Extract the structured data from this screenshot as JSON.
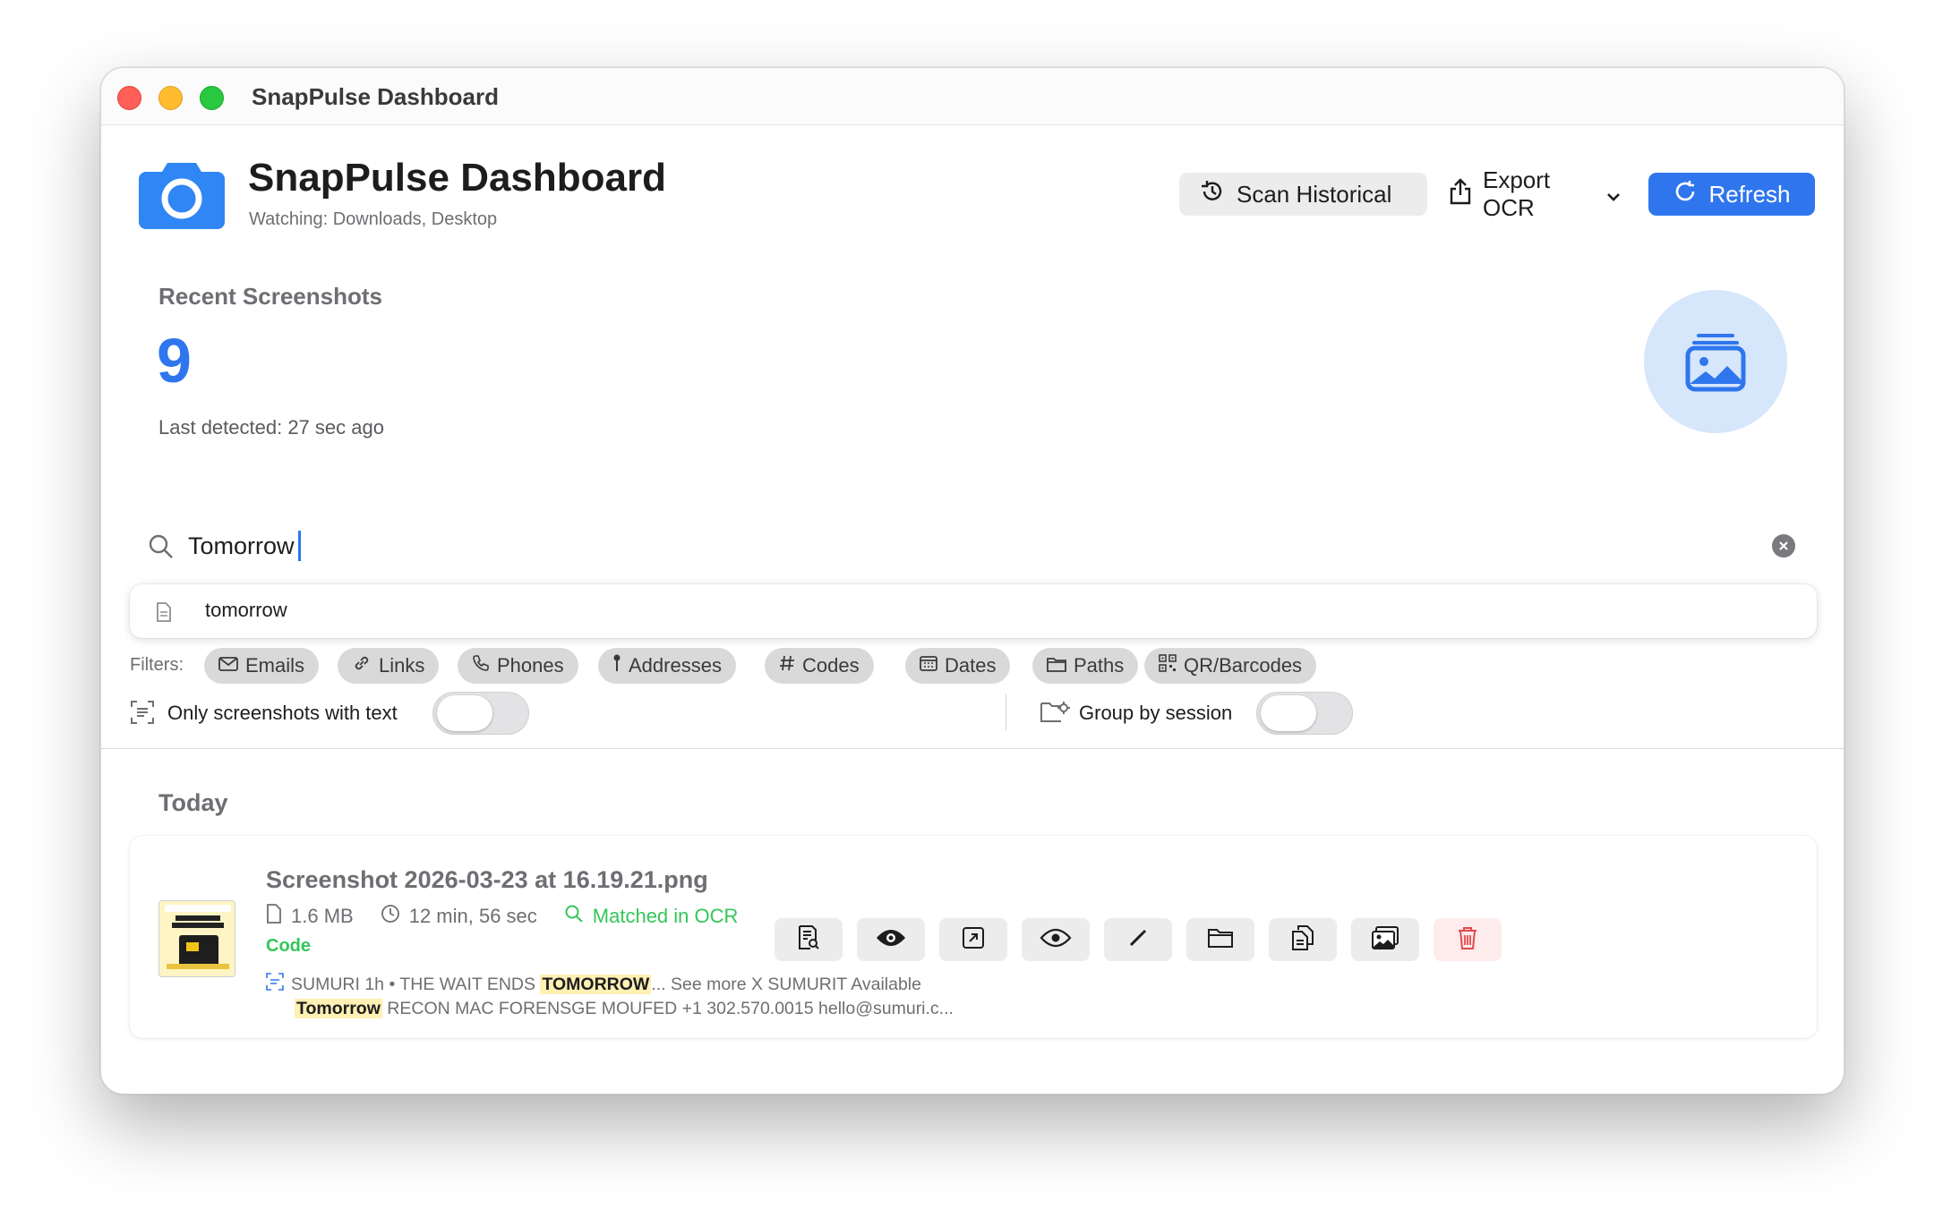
{
  "window": {
    "title": "SnapPulse Dashboard"
  },
  "header": {
    "title": "SnapPulse Dashboard",
    "watching": "Watching: Downloads, Desktop",
    "scan_label": "Scan Historical",
    "export_label": "Export OCR",
    "refresh_label": "Refresh"
  },
  "stats": {
    "label": "Recent Screenshots",
    "count": "9",
    "last_detected": "Last detected: 27 sec ago"
  },
  "search": {
    "value": "Tomorrow",
    "suggestion": "tomorrow"
  },
  "filters": {
    "label": "Filters:",
    "chips": [
      "Emails",
      "Links",
      "Phones",
      "Addresses",
      "Codes",
      "Dates",
      "Paths",
      "QR/Barcodes"
    ],
    "only_text_label": "Only screenshots with text",
    "group_label": "Group by session",
    "only_text_on": false,
    "group_on": false
  },
  "list": {
    "section": "Today",
    "items": [
      {
        "name": "Screenshot 2026-03-23 at 16.19.21.png",
        "size": "1.6 MB",
        "age": "12 min, 56 sec",
        "match": "Matched in OCR",
        "tag": "Code",
        "ocr_a": "SUMURI 1h • THE WAIT ENDS ",
        "ocr_hl1": "TOMORROW",
        "ocr_b": "... See more X SUMURIT Available",
        "ocr_hl2": "Tomorrow",
        "ocr_c": " RECON MAC FORENSGE MOUFED +1 302.570.0015 hello@sumuri.c..."
      }
    ]
  },
  "colors": {
    "accent": "#2f76ee",
    "match": "#34c759",
    "delete": "#e5484d"
  }
}
